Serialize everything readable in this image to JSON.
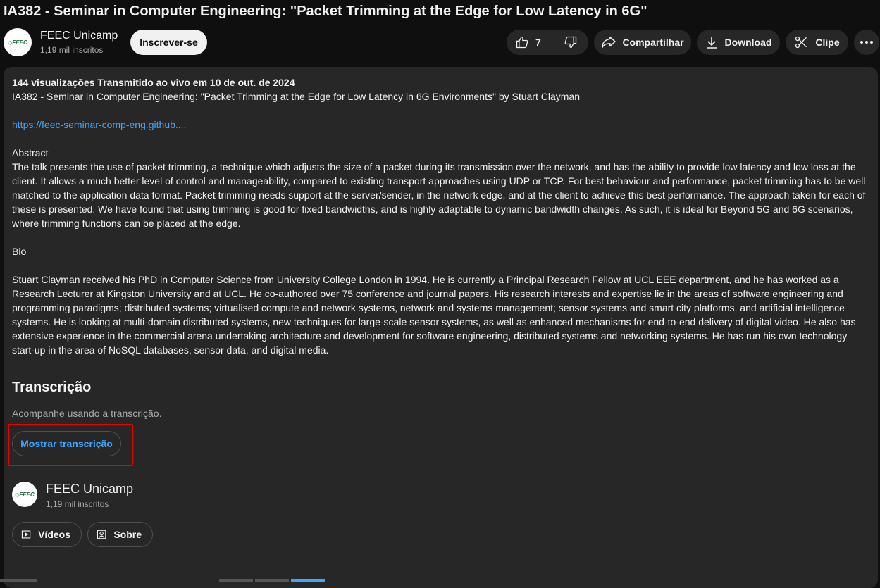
{
  "video": {
    "title": "IA382 - Seminar in Computer Engineering: \"Packet Trimming at the Edge for Low Latency in 6G\""
  },
  "owner": {
    "name": "FEEC Unicamp",
    "subscribers": "1,19 mil inscritos",
    "subscribe_label": "Inscrever-se",
    "logo_text": "FEEC"
  },
  "actions": {
    "like_count": "7",
    "share_label": "Compartilhar",
    "download_label": "Download",
    "clip_label": "Clipe"
  },
  "description": {
    "meta": "144 visualizações  Transmitido ao vivo em 10 de out. de 2024",
    "line1": "IA382 - Seminar in Computer Engineering: \"Packet Trimming at the Edge for Low Latency in 6G Environments\" by Stuart Clayman",
    "link": "https://feec-seminar-comp-eng.github....",
    "abstract_heading": "Abstract",
    "abstract": "The talk presents the use of packet trimming, a technique which adjusts the size of a packet during its transmission over the network, and has the ability to provide low latency and low loss at the client. It allows a much better level of control and manageability, compared to existing transport approaches using UDP or TCP. For best behaviour and performance, packet trimming has to be well matched to the application data format. Packet trimming needs support at the server/sender, in the network edge, and at the client to achieve this best performance. The approach taken for each of these is presented. We have found that using trimming is good for fixed bandwidths, and is highly adaptable to dynamic bandwidth changes. As such, it is ideal for Beyond 5G and 6G scenarios, where trimming functions can be placed at the edge.",
    "bio_heading": "Bio",
    "bio": "Stuart Clayman received his PhD in Computer Science from University College London in 1994. He is currently a Principal Research Fellow at UCL EEE department, and he has worked as a Research Lecturer at Kingston University and at UCL. He co-authored over 75 conference and journal papers. His research interests and expertise lie in the areas of software engineering and programming paradigms; distributed systems; virtualised compute and network systems, network and systems management; sensor systems and smart city platforms, and artificial intelligence systems. He is looking at multi-domain distributed systems, new techniques for large-scale sensor systems, as well as enhanced mechanisms for end-to-end delivery of digital video. He also has extensive experience in the commercial arena undertaking architecture and development for software engineering, distributed systems and networking systems. He has run his own technology start-up in the area of NoSQL databases, sensor data, and digital media."
  },
  "transcript": {
    "heading": "Transcrição",
    "subtitle": "Acompanhe usando a transcrição.",
    "button_label": "Mostrar transcrição"
  },
  "channel_card": {
    "name": "FEEC Unicamp",
    "subscribers": "1,19 mil inscritos",
    "videos_label": "Vídeos",
    "about_label": "Sobre"
  },
  "colors": {
    "background": "#0f0f0f",
    "panel": "#272727",
    "link": "#3ea6ff",
    "highlight": "#e00000"
  }
}
